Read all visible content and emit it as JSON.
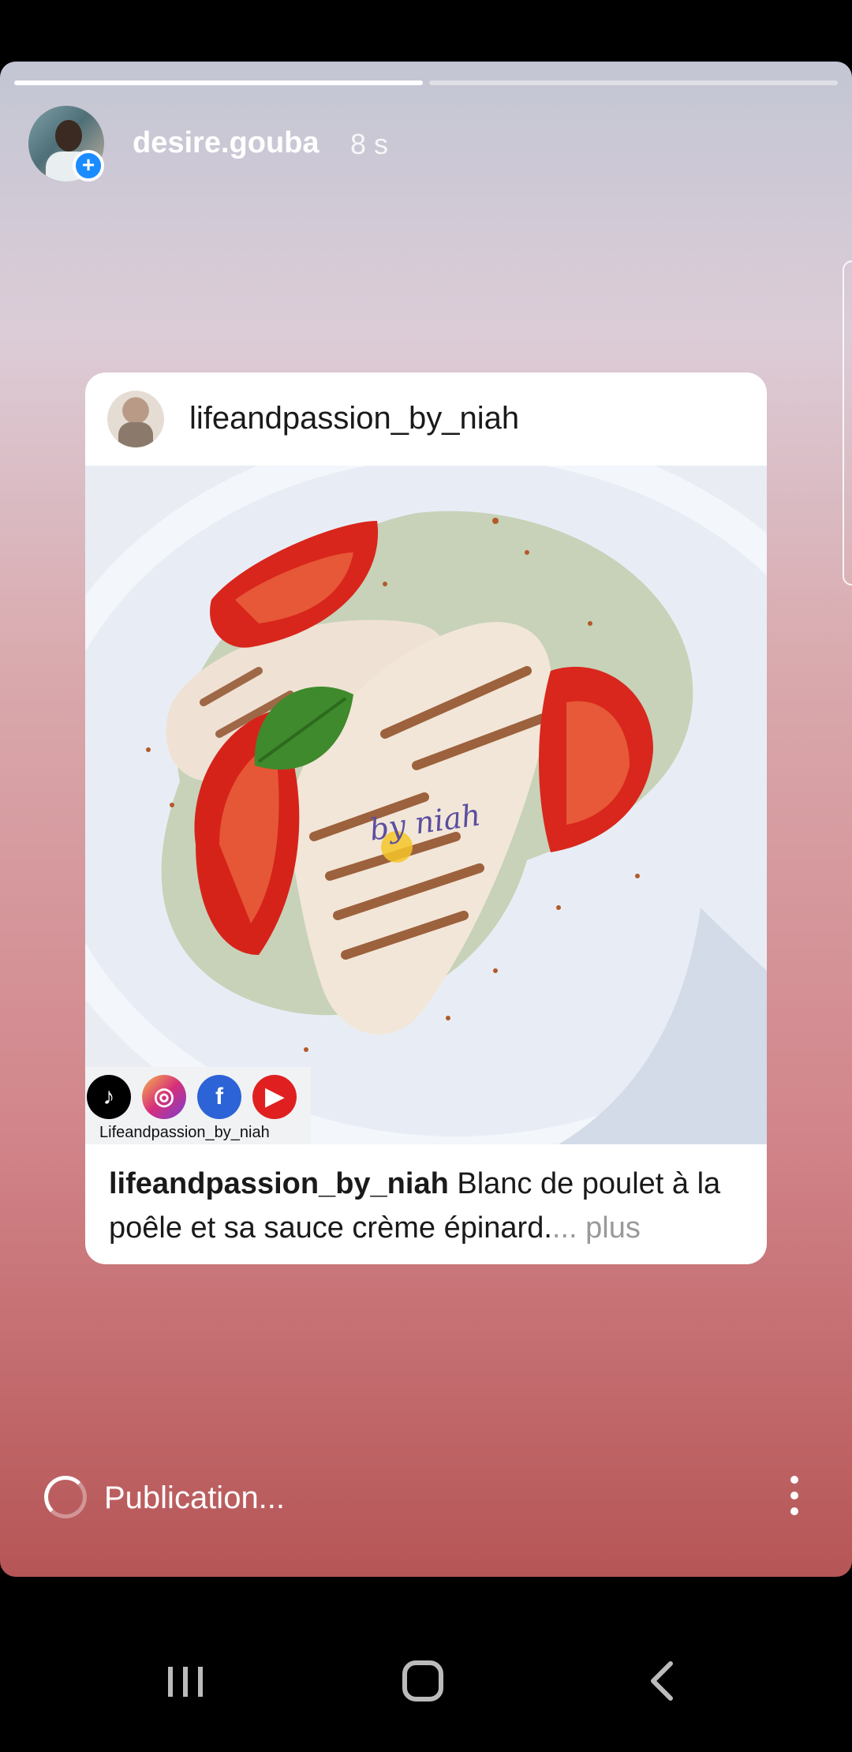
{
  "story": {
    "progress": [
      1.0,
      0.0
    ],
    "username": "desire.gouba",
    "time": "8 s",
    "avatar_icon": "profile-photo",
    "add_icon": "plus-icon"
  },
  "card": {
    "username": "lifeandpassion_by_niah",
    "photo_watermark": "by niah",
    "social_label": "Lifeandpassion_by_niah",
    "social_icons": [
      "tiktok-icon",
      "instagram-icon",
      "facebook-icon",
      "youtube-icon"
    ],
    "caption_user": "lifeandpassion_by_niah",
    "caption_text": " Blanc de poulet à la poêle et sa sauce crème épinard.",
    "caption_ellipsis": "... plus"
  },
  "footer": {
    "status": "Publication...",
    "menu_icon": "more-vertical-icon"
  },
  "navbar": {
    "buttons": [
      "recent-apps-icon",
      "home-icon",
      "back-icon"
    ]
  },
  "colors": {
    "accent": "#1a8cff",
    "gradient_top": "#c3c6d4",
    "gradient_bottom": "#b65556"
  }
}
